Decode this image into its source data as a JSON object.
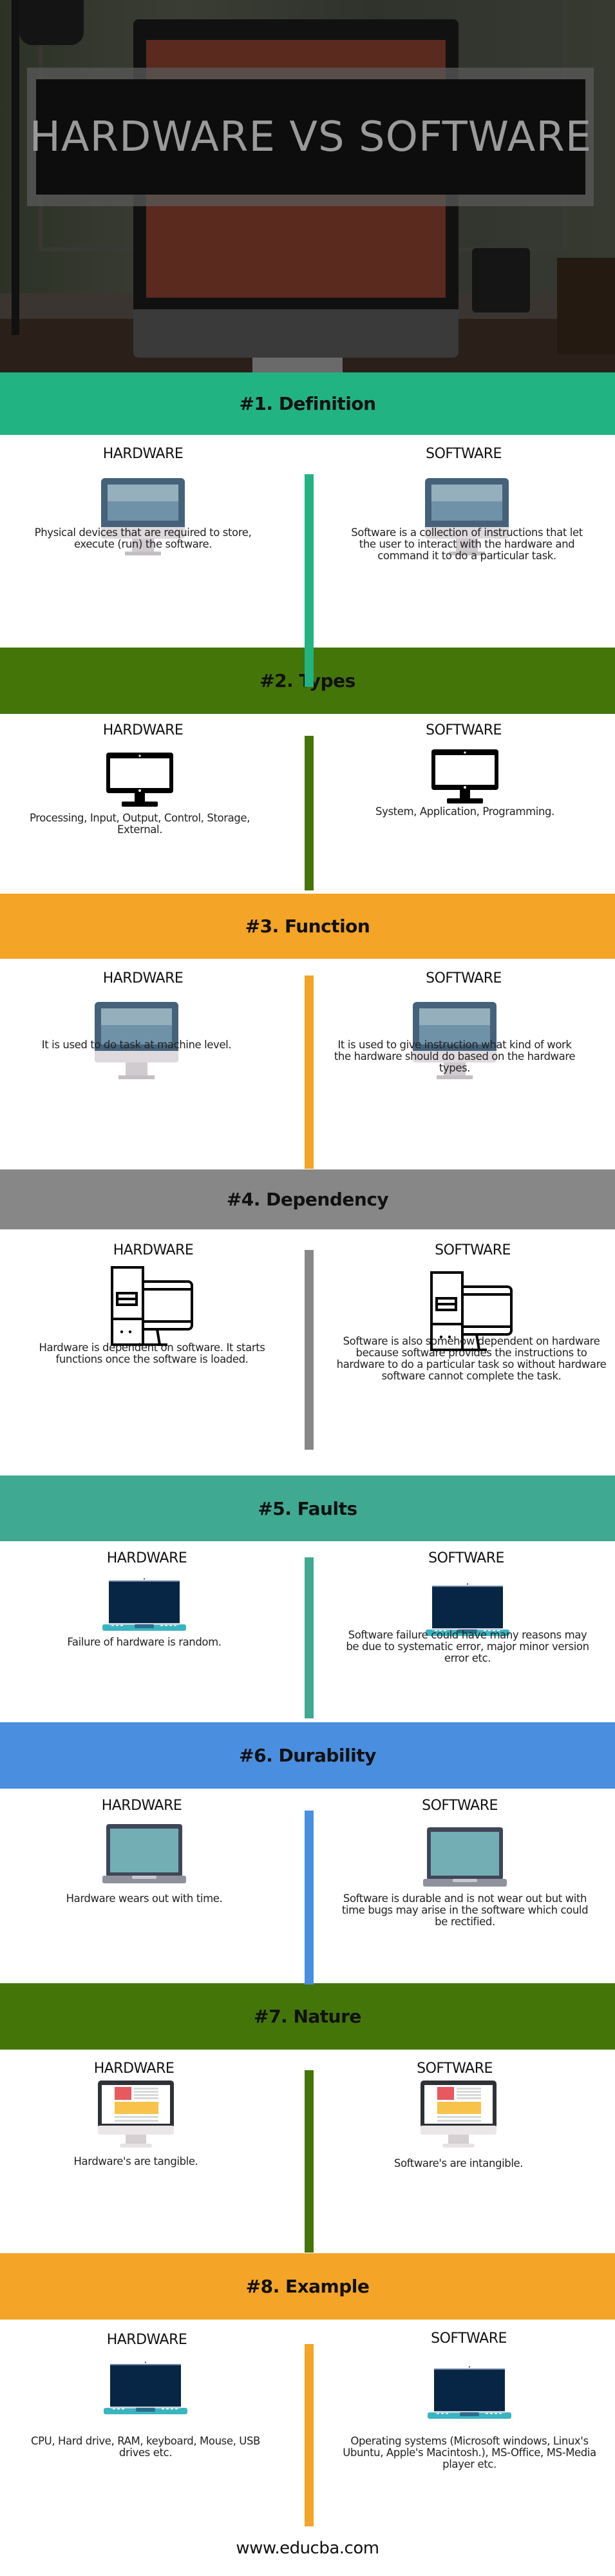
{
  "hero": {
    "title": "HARDWARE VS SOFTWARE"
  },
  "colors": {
    "definition": "#22b383",
    "types": "#447508",
    "function": "#f4a426",
    "dependency": "#878787",
    "faults": "#3fa991",
    "durability": "#4a8ee0",
    "nature": "#447508",
    "example": "#f4a426"
  },
  "sections": [
    {
      "title": "#1. Definition",
      "icon": "imac-flat-icon",
      "hardware_label": "HARDWARE",
      "software_label": "SOFTWARE",
      "hardware_text": "Physical devices that are required to store, execute (run) the software.",
      "software_text": "Software is a collection of instructions that let the user to interact with the hardware and command it to do a particular task."
    },
    {
      "title": "#2. Types",
      "icon": "monitor-black-icon",
      "hardware_label": "HARDWARE",
      "software_label": "SOFTWARE",
      "hardware_text": "Processing, Input, Output, Control, Storage, External.",
      "software_text": "System, Application, Programming."
    },
    {
      "title": "#3. Function",
      "icon": "imac-flat-icon",
      "hardware_label": "HARDWARE",
      "software_label": "SOFTWARE",
      "hardware_text": "It is used to do task at machine level.",
      "software_text": "It is used to give instruction what kind of work the hardware should do based on the hardware types."
    },
    {
      "title": "#4. Dependency",
      "icon": "desktop-tower-outline-icon",
      "hardware_label": "HARDWARE",
      "software_label": "SOFTWARE",
      "hardware_text": "Hardware is dependent on software. It starts functions once the software is loaded.",
      "software_text": "Software is also somehow dependent on hardware because software provides the instructions to hardware to do a particular task so without hardware software cannot complete the task."
    },
    {
      "title": "#5. Faults",
      "icon": "laptop-navy-icon",
      "hardware_label": "HARDWARE",
      "software_label": "SOFTWARE",
      "hardware_text": "Failure of hardware is random.",
      "software_text": "Software failure could have many reasons may be due to systematic error, major minor version error etc."
    },
    {
      "title": "#6. Durability",
      "icon": "laptop-teal-icon",
      "hardware_label": "HARDWARE",
      "software_label": "SOFTWARE",
      "hardware_text": "Hardware wears out with time.",
      "software_text": "Software is durable and is not wear out but with time bugs may arise in the software which could be rectified."
    },
    {
      "title": "#7. Nature",
      "icon": "imac-webpage-icon",
      "hardware_label": "HARDWARE",
      "software_label": "SOFTWARE",
      "hardware_text": "Hardware's are tangible.",
      "software_text": "Software's are intangible."
    },
    {
      "title": "#8. Example",
      "icon": "laptop-navy-icon",
      "hardware_label": "HARDWARE",
      "software_label": "SOFTWARE",
      "hardware_text": "CPU, Hard drive, RAM, keyboard, Mouse, USB drives etc.",
      "software_text": "Operating systems (Microsoft windows, Linux's Ubuntu, Apple's Macintosh.), MS-Office, MS-Media player etc."
    }
  ],
  "footer": {
    "url": "www.educba.com"
  }
}
